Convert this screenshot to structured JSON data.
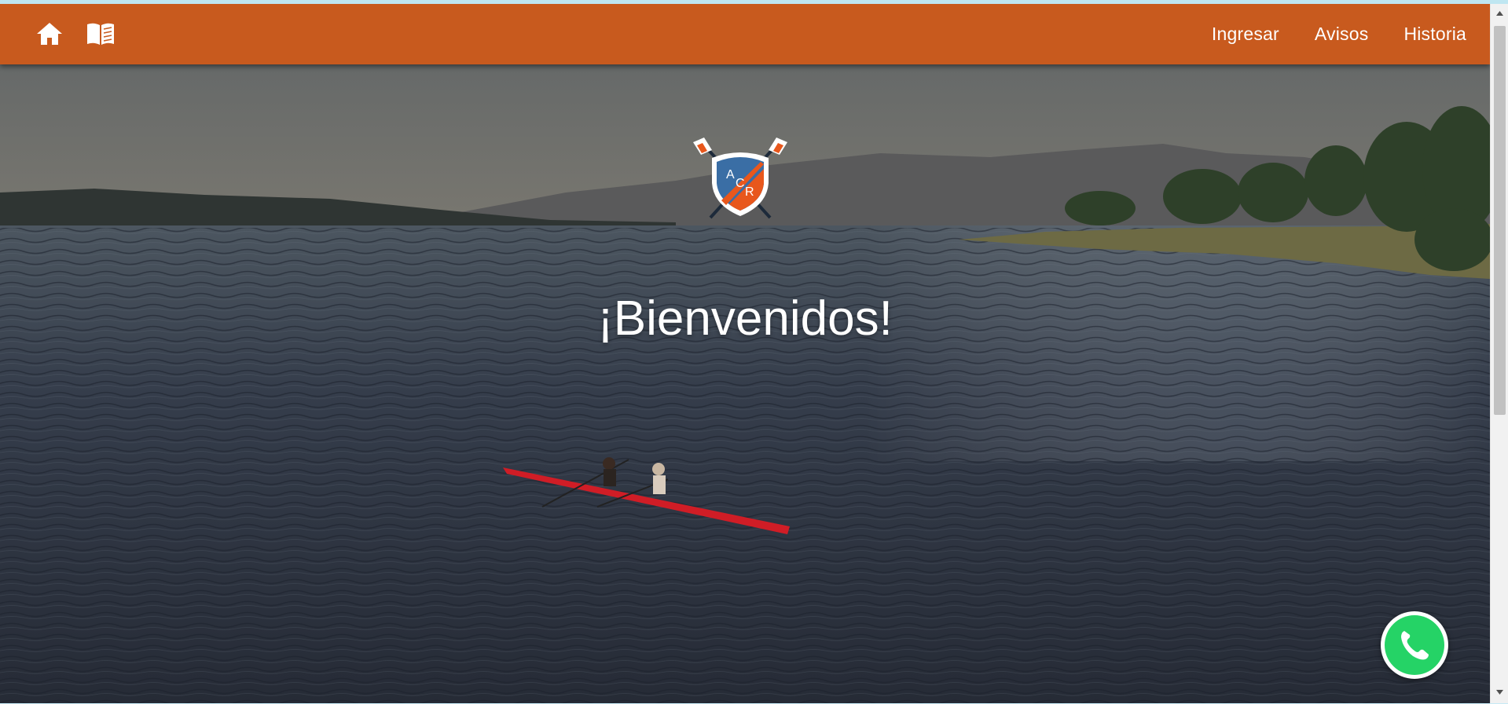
{
  "navbar": {
    "color": "#c85a1e",
    "icons": [
      {
        "name": "home-icon"
      },
      {
        "name": "book-icon"
      }
    ],
    "links": [
      "Ingresar",
      "Avisos",
      "Historia"
    ]
  },
  "hero": {
    "heading": "¡Bienvenidos!",
    "logo": {
      "letters": [
        "A",
        "C",
        "R"
      ],
      "colors": {
        "blue": "#3a6ea5",
        "orange": "#e8571c"
      }
    }
  },
  "whatsapp": {
    "icon": "whatsapp-phone-icon",
    "color": "#25d366"
  }
}
